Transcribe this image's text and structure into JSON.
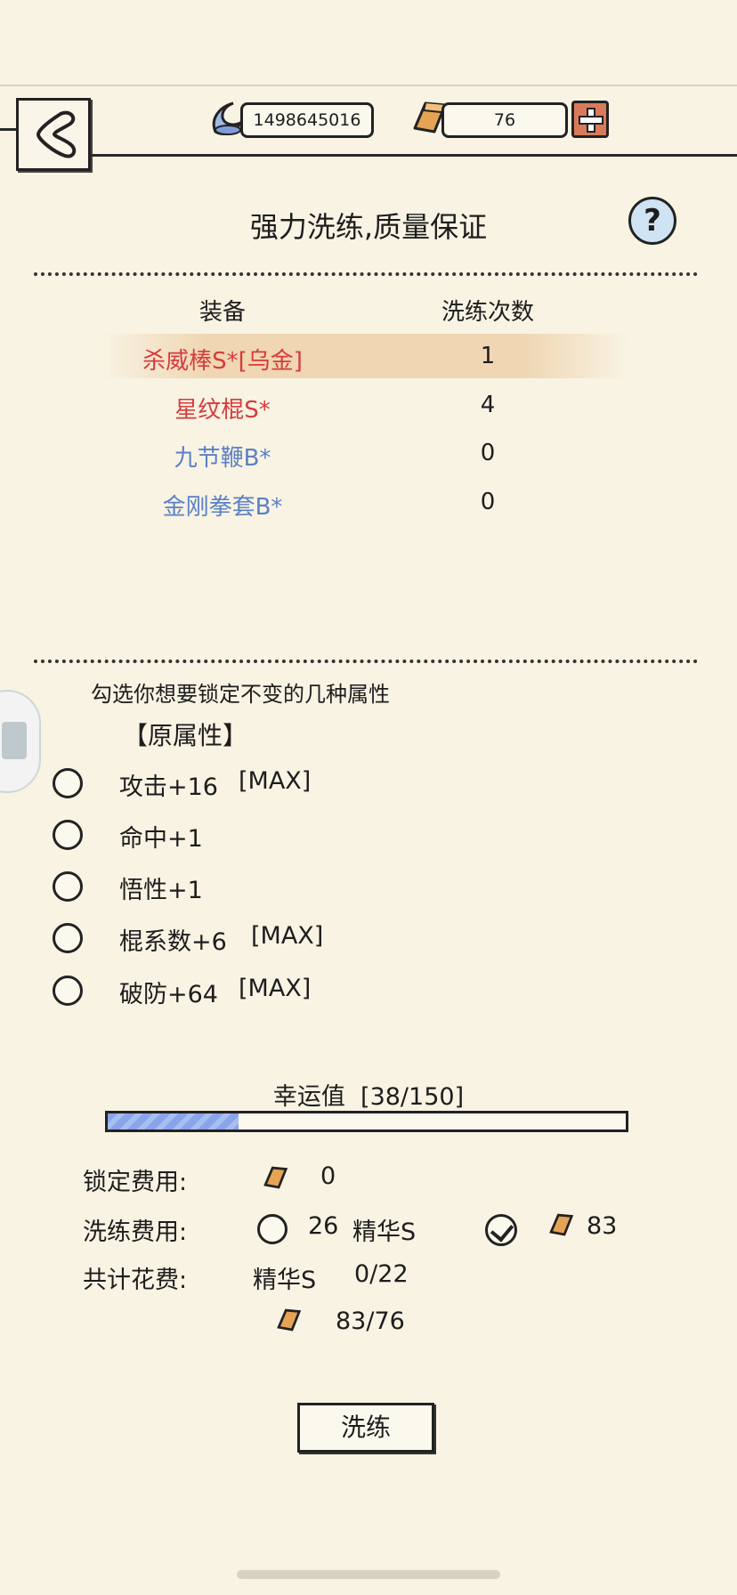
{
  "header": {
    "currency_silver": "1498645016",
    "currency_gold": "76",
    "silver_icon": "moon-coin-icon",
    "gold_icon": "gold-bar-icon"
  },
  "page": {
    "title": "强力洗练,质量保证"
  },
  "equipment_table": {
    "col_equipment": "装备",
    "col_count": "洗练次数",
    "rows": [
      {
        "name": "杀威棒S*[乌金]",
        "count": "1",
        "color": "#d53c3c"
      },
      {
        "name": "星纹棍S*",
        "count": "4",
        "color": "#d53c3c"
      },
      {
        "name": "九节鞭B*",
        "count": "0",
        "color": "#5b80c6"
      },
      {
        "name": "金刚拳套B*",
        "count": "0",
        "color": "#5b80c6"
      }
    ]
  },
  "lock_section": {
    "hint": "勾选你想要锁定不变的几种属性",
    "heading": "【原属性】",
    "attributes": [
      {
        "label": "攻击+16",
        "tag": "[MAX]"
      },
      {
        "label": "命中+1",
        "tag": ""
      },
      {
        "label": "悟性+1",
        "tag": ""
      },
      {
        "label": "棍系数+6",
        "tag": "[MAX]"
      },
      {
        "label": "破防+64",
        "tag": "[MAX]"
      }
    ]
  },
  "luck": {
    "label": "幸运值",
    "value_text": "[38/150]",
    "progress_fraction": 0.253
  },
  "costs": {
    "lock_label": "锁定费用:",
    "lock_value": "0",
    "wash_label": "洗练费用:",
    "wash_essence_amount": "26",
    "wash_essence_name": "精华S",
    "wash_gold_amount": "83",
    "total_label": "共计花费:",
    "total_essence_name": "精华S",
    "total_essence_value": "0/22",
    "total_gold_value": "83/76"
  },
  "actions": {
    "wash_button": "洗练"
  }
}
